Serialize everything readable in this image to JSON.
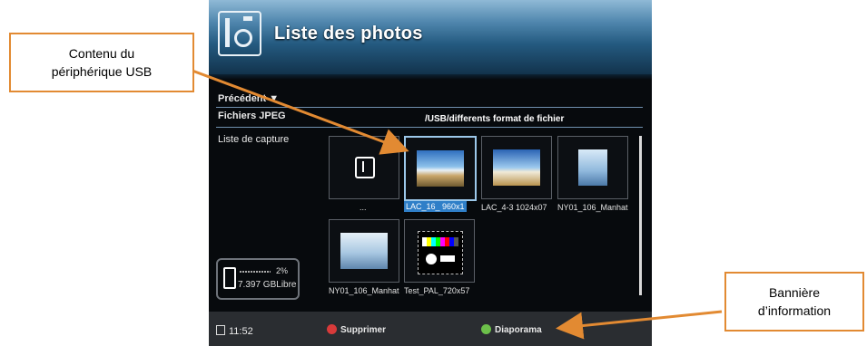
{
  "window": {
    "title": "Liste des photos"
  },
  "nav": {
    "previous": "Précédent",
    "jpeg_files": "Fichiers JPEG",
    "capture_list": "Liste de capture",
    "path": "/USB/differents format de fichier"
  },
  "thumbnails": [
    {
      "caption": "..."
    },
    {
      "caption": "LAC_16_ 960x1"
    },
    {
      "caption": "LAC_4-3 1024x07"
    },
    {
      "caption": "NY01_106_Manhat"
    },
    {
      "caption": "NY01_106_Manhat"
    },
    {
      "caption": "Test_PAL_720x57"
    }
  ],
  "usb": {
    "percent": "2%",
    "free_space": "7.397 GBLibre",
    "used_fraction": 0.02
  },
  "status_bar": {
    "time": "11:52",
    "delete_label": "Supprimer",
    "slideshow_label": "Diaporama"
  },
  "callouts": {
    "usb_contents": "Contenu du périphérique USB",
    "info_banner": "Bannière d’information"
  },
  "colors": {
    "callout_border": "#e28a32",
    "selection": "#2f7fc8",
    "delete": "#d83a3a",
    "slideshow": "#6cc04a"
  }
}
